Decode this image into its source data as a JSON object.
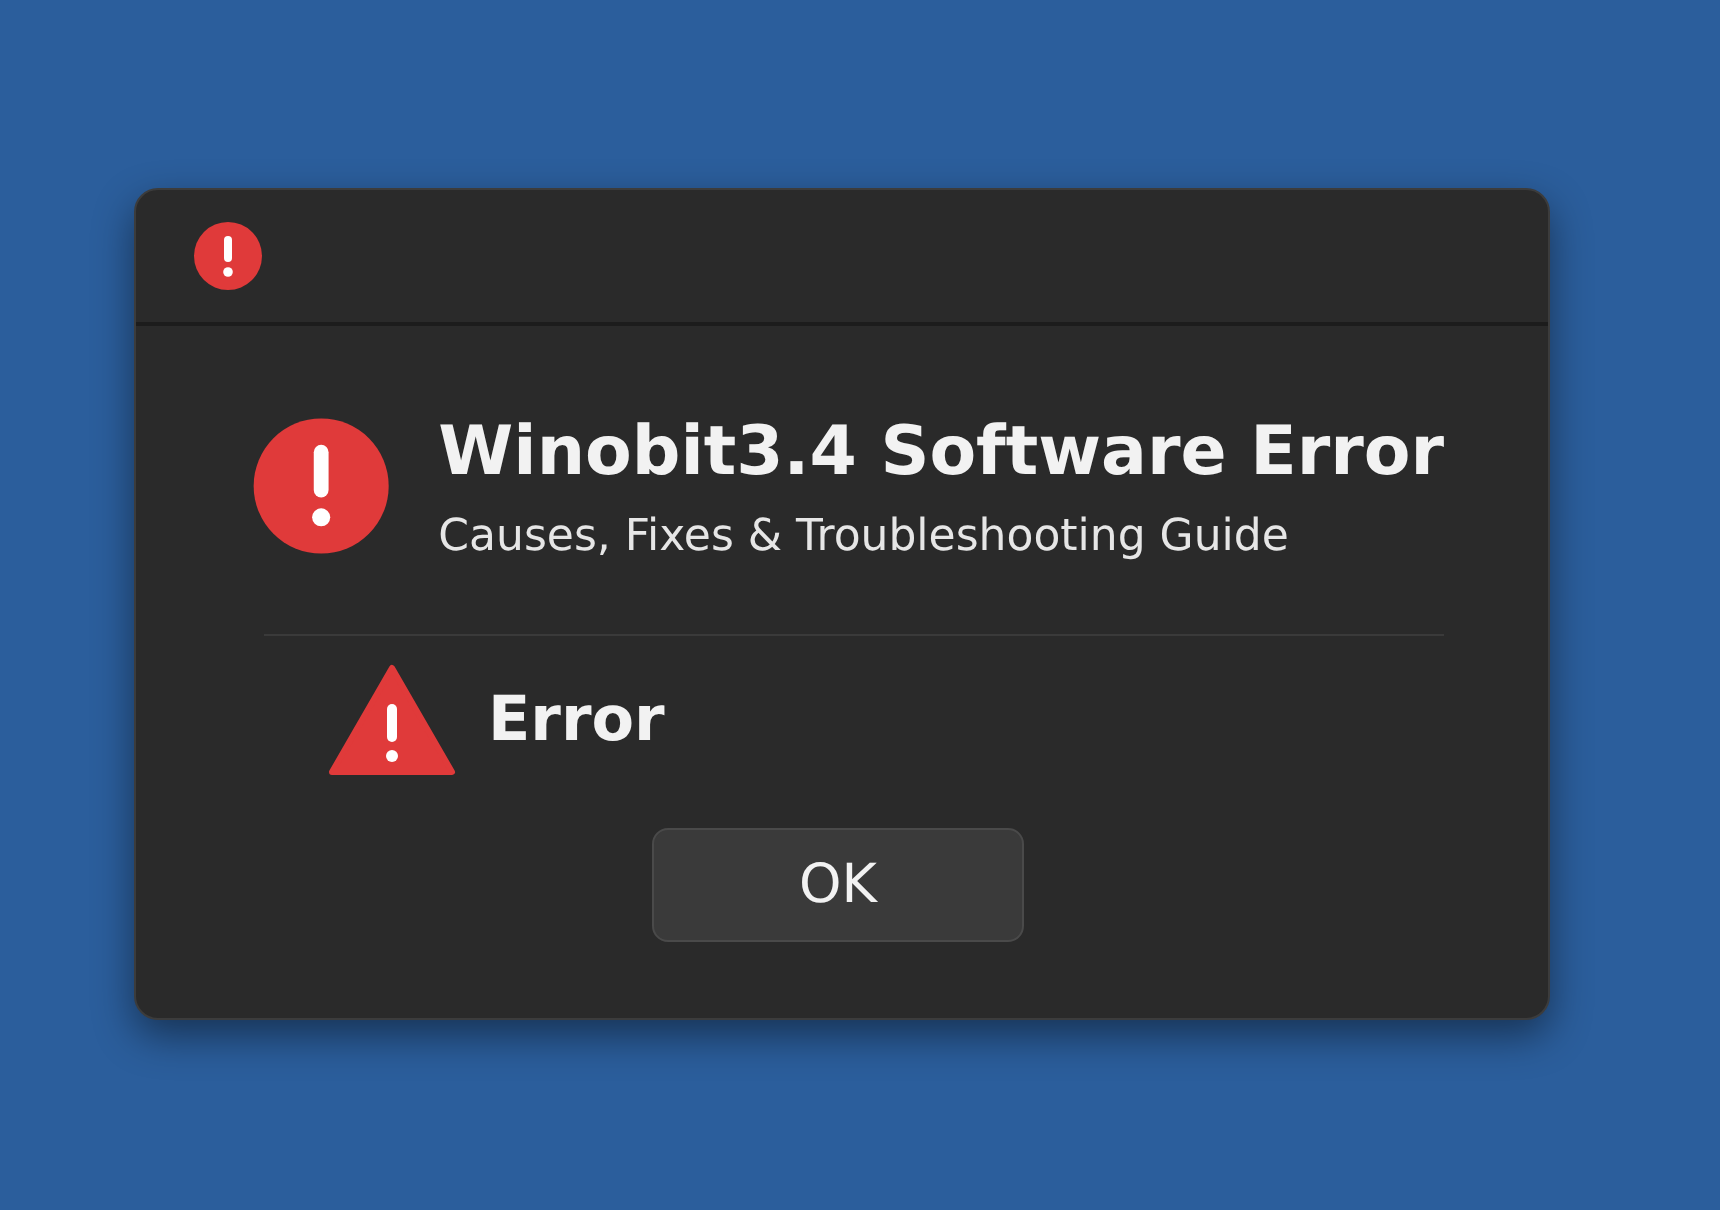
{
  "dialog": {
    "heading": "Winobit3.4 Software Error",
    "subheading": "Causes, Fixes & Troubleshooting Guide",
    "message": "Error",
    "buttons": [
      "OK"
    ]
  }
}
